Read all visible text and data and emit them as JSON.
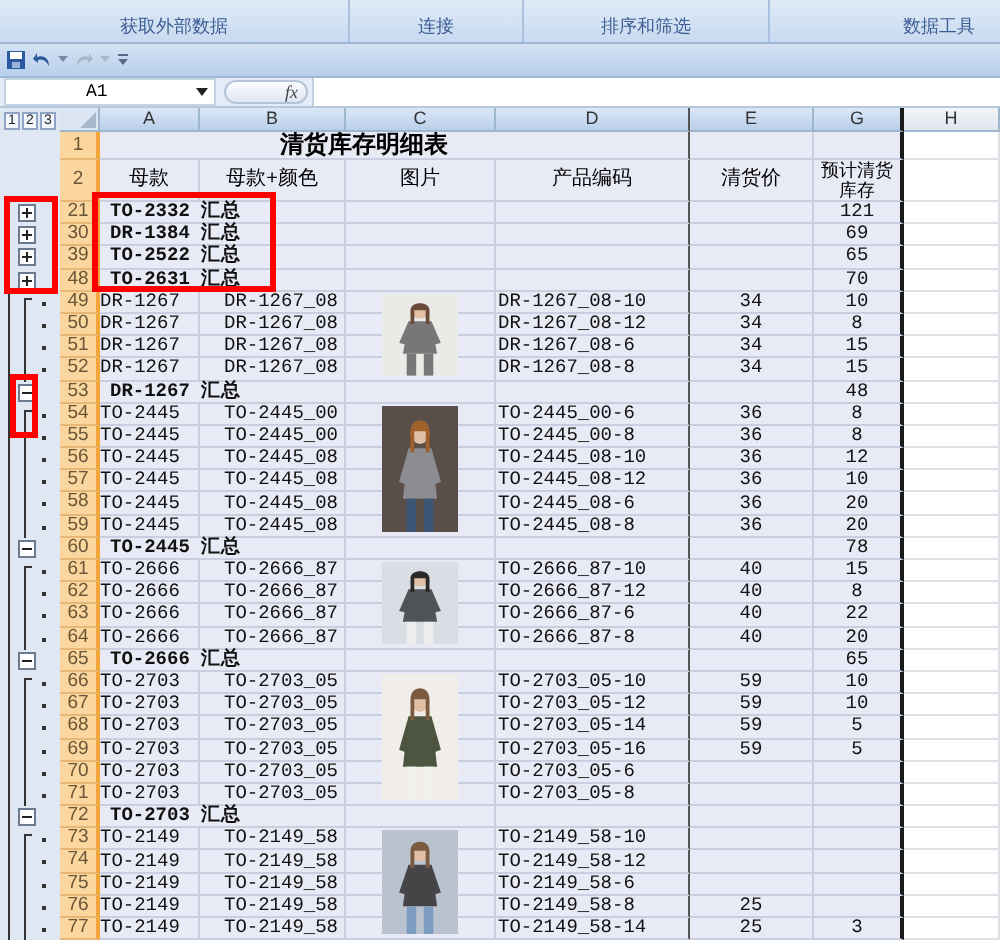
{
  "ribbon": {
    "groups": [
      "获取外部数据",
      "连接",
      "排序和筛选",
      "数据工具"
    ]
  },
  "formula_bar": {
    "name_box": "A1",
    "function_label": "fx"
  },
  "outline_levels": [
    "1",
    "2",
    "3"
  ],
  "columns": [
    "A",
    "B",
    "C",
    "D",
    "E",
    "G",
    "H"
  ],
  "title_row": {
    "number": "1",
    "title": "清货库存明细表"
  },
  "header_row": {
    "number": "2",
    "cells": [
      "母款",
      "母款+颜色",
      "图片",
      "产品编码",
      "清货价",
      "预计清货库存"
    ]
  },
  "groups": [
    {
      "expanded": false,
      "summary": {
        "number": "21",
        "label": "TO-2332 汇总",
        "stock": "121"
      }
    },
    {
      "expanded": false,
      "summary": {
        "number": "30",
        "label": "DR-1384 汇总",
        "stock": "69"
      }
    },
    {
      "expanded": false,
      "summary": {
        "number": "39",
        "label": "TO-2522 汇总",
        "stock": "65"
      }
    },
    {
      "expanded": false,
      "summary": {
        "number": "48",
        "label": "TO-2631 汇总",
        "stock": "70"
      }
    },
    {
      "expanded": true,
      "picture": {
        "kind": "picture"
      },
      "summary": {
        "number": "53",
        "label": "DR-1267 汇总",
        "stock": "48"
      },
      "details": [
        {
          "number": "49",
          "style": "DR-1267",
          "variant": "DR-1267_08",
          "code": "DR-1267_08-10",
          "price": "34",
          "stock": "10"
        },
        {
          "number": "50",
          "style": "DR-1267",
          "variant": "DR-1267_08",
          "code": "DR-1267_08-12",
          "price": "34",
          "stock": "8"
        },
        {
          "number": "51",
          "style": "DR-1267",
          "variant": "DR-1267_08",
          "code": "DR-1267_08-6",
          "price": "34",
          "stock": "15"
        },
        {
          "number": "52",
          "style": "DR-1267",
          "variant": "DR-1267_08",
          "code": "DR-1267_08-8",
          "price": "34",
          "stock": "15"
        }
      ]
    },
    {
      "expanded": true,
      "picture": {
        "kind": "picture"
      },
      "summary": {
        "number": "60",
        "label": "TO-2445 汇总",
        "stock": "78"
      },
      "details": [
        {
          "number": "54",
          "style": "TO-2445",
          "variant": "TO-2445_00",
          "code": "TO-2445_00-6",
          "price": "36",
          "stock": "8"
        },
        {
          "number": "55",
          "style": "TO-2445",
          "variant": "TO-2445_00",
          "code": "TO-2445_00-8",
          "price": "36",
          "stock": "8"
        },
        {
          "number": "56",
          "style": "TO-2445",
          "variant": "TO-2445_08",
          "code": "TO-2445_08-10",
          "price": "36",
          "stock": "12"
        },
        {
          "number": "57",
          "style": "TO-2445",
          "variant": "TO-2445_08",
          "code": "TO-2445_08-12",
          "price": "36",
          "stock": "10"
        },
        {
          "number": "58",
          "style": "TO-2445",
          "variant": "TO-2445_08",
          "code": "TO-2445_08-6",
          "price": "36",
          "stock": "20"
        },
        {
          "number": "59",
          "style": "TO-2445",
          "variant": "TO-2445_08",
          "code": "TO-2445_08-8",
          "price": "36",
          "stock": "20"
        }
      ]
    },
    {
      "expanded": true,
      "picture": {
        "kind": "picture"
      },
      "summary": {
        "number": "65",
        "label": "TO-2666 汇总",
        "stock": "65"
      },
      "details": [
        {
          "number": "61",
          "style": "TO-2666",
          "variant": "TO-2666_87",
          "code": "TO-2666_87-10",
          "price": "40",
          "stock": "15"
        },
        {
          "number": "62",
          "style": "TO-2666",
          "variant": "TO-2666_87",
          "code": "TO-2666_87-12",
          "price": "40",
          "stock": "8"
        },
        {
          "number": "63",
          "style": "TO-2666",
          "variant": "TO-2666_87",
          "code": "TO-2666_87-6",
          "price": "40",
          "stock": "22"
        },
        {
          "number": "64",
          "style": "TO-2666",
          "variant": "TO-2666_87",
          "code": "TO-2666_87-8",
          "price": "40",
          "stock": "20"
        }
      ]
    },
    {
      "expanded": true,
      "picture": {
        "kind": "picture"
      },
      "summary": {
        "number": "72",
        "label": "TO-2703 汇总"
      },
      "details": [
        {
          "number": "66",
          "style": "TO-2703",
          "variant": "TO-2703_05",
          "code": "TO-2703_05-10",
          "price": "59",
          "stock": "10"
        },
        {
          "number": "67",
          "style": "TO-2703",
          "variant": "TO-2703_05",
          "code": "TO-2703_05-12",
          "price": "59",
          "stock": "10"
        },
        {
          "number": "68",
          "style": "TO-2703",
          "variant": "TO-2703_05",
          "code": "TO-2703_05-14",
          "price": "59",
          "stock": "5"
        },
        {
          "number": "69",
          "style": "TO-2703",
          "variant": "TO-2703_05",
          "code": "TO-2703_05-16",
          "price": "59",
          "stock": "5"
        },
        {
          "number": "70",
          "style": "TO-2703",
          "variant": "TO-2703_05",
          "code": "TO-2703_05-6"
        },
        {
          "number": "71",
          "style": "TO-2703",
          "variant": "TO-2703_05",
          "code": "TO-2703_05-8"
        }
      ]
    },
    {
      "expanded": true,
      "picture": {
        "kind": "picture"
      },
      "details": [
        {
          "number": "73",
          "style": "TO-2149",
          "variant": "TO-2149_58",
          "code": "TO-2149_58-10"
        },
        {
          "number": "74",
          "style": "TO-2149",
          "variant": "TO-2149_58",
          "code": "TO-2149_58-12"
        },
        {
          "number": "75",
          "style": "TO-2149",
          "variant": "TO-2149_58",
          "code": "TO-2149_58-6"
        },
        {
          "number": "76",
          "style": "TO-2149",
          "variant": "TO-2149_58",
          "code": "TO-2149_58-8",
          "price": "25"
        },
        {
          "number": "77",
          "style": "TO-2149",
          "variant": "TO-2149_58",
          "code": "TO-2149_58-14",
          "price": "25",
          "stock": "3"
        }
      ]
    }
  ],
  "highlights": [
    {
      "kind": "collapsed_buttons"
    },
    {
      "kind": "collapsed_labels"
    },
    {
      "kind": "expanded_button"
    }
  ]
}
